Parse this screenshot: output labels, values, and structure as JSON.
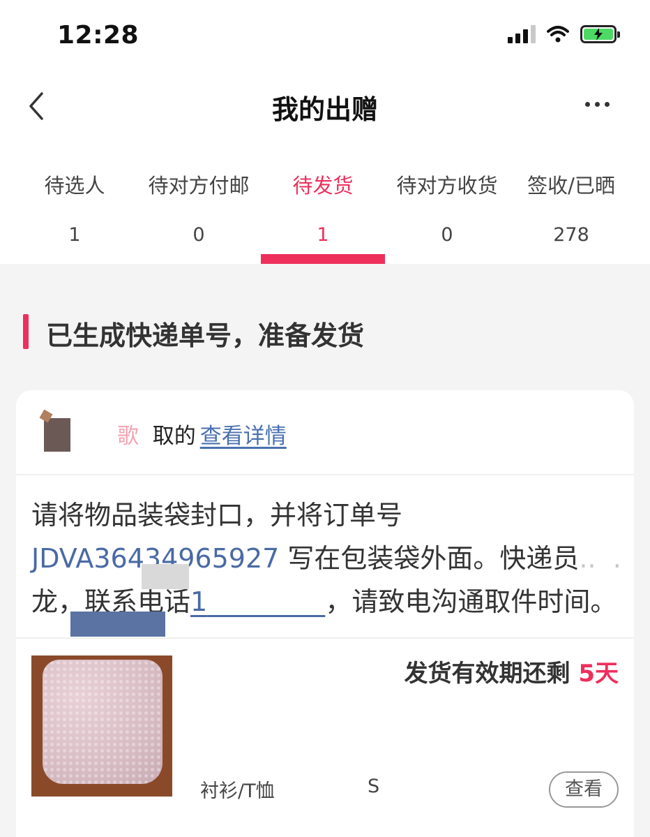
{
  "status_bar": {
    "time": "12:28"
  },
  "nav": {
    "title": "我的出赠"
  },
  "tabs": [
    {
      "label": "待选人",
      "count": "1"
    },
    {
      "label": "待对方付邮",
      "count": "0"
    },
    {
      "label": "待发货",
      "count": "1"
    },
    {
      "label": "待对方收货",
      "count": "0"
    },
    {
      "label": "签收/已晒",
      "count": "278"
    }
  ],
  "active_tab": "待发货",
  "section": {
    "title": "已生成快递单号，准备发货"
  },
  "card": {
    "receiver_partial": "歌",
    "receiver_suffix": "取的",
    "details_link": "查看详情",
    "instr_part1": "请将物品装袋封口，并将订单号 ",
    "order_number": "JDVA36434965927",
    "instr_part2": " 写在包装袋外面。快递员",
    "courier_suffix": "龙，联系电话",
    "phone_partial": "1",
    "instr_part3": "，请致电沟通取件时间。",
    "deadline_label": "发货有效期还剩 ",
    "deadline_value": "5天",
    "category": "衬衫/T恤",
    "size": "S",
    "view_label": "查看"
  },
  "colors": {
    "accent": "#ee2f5c",
    "link": "#4a6aa5"
  }
}
